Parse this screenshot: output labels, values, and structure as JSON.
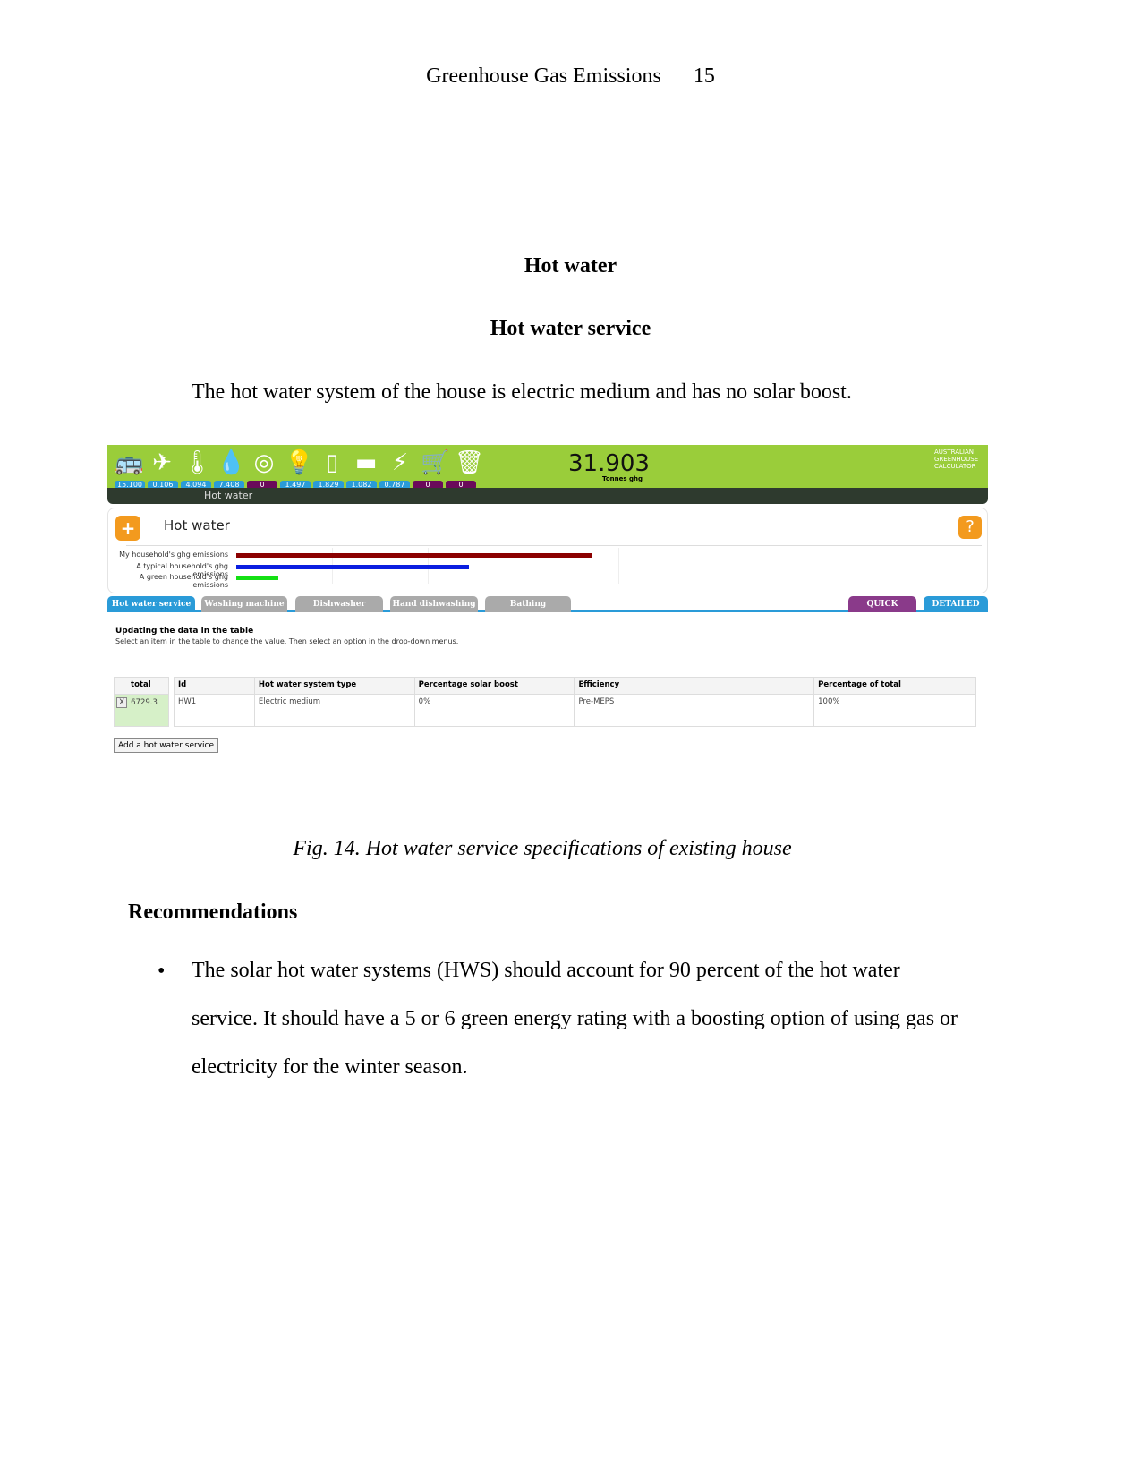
{
  "header": {
    "title": "Greenhouse Gas Emissions",
    "page": "15"
  },
  "heading1": "Hot water",
  "heading2": "Hot water service",
  "intro": "The hot water system of the house is electric medium and has no solar boost.",
  "screenshot": {
    "colors": {
      "topbar": "#9acd3a",
      "accent": "#2a9bd8",
      "orange": "#f39a1e"
    },
    "icons": [
      "transport-icon",
      "plane-icon",
      "heating-cooling-icon",
      "hot-water-icon",
      "washing-machine-icon",
      "lightbulb-icon",
      "fridge-icon",
      "cooking-icon",
      "appliances-icon",
      "shopping-cart-icon",
      "waste-bin-icon"
    ],
    "badges": [
      "15.100",
      "0.106",
      "4.094",
      "7.408",
      "0",
      "1.497",
      "1.829",
      "1.082",
      "0.787",
      "0",
      "0"
    ],
    "total": "31.903",
    "total_unit": "Tonnes ghg",
    "logo": "AUSTRALIAN GREENHOUSE CALCULATOR",
    "section": "Hot water",
    "panel_title": "Hot water",
    "bars": [
      {
        "label": "My household's ghg emissions",
        "fraction": 0.93,
        "color": "#8b0000"
      },
      {
        "label": "A typical household's ghg emissions",
        "fraction": 0.61,
        "color": "#0a1ee0"
      },
      {
        "label": "A green household's ghg emissions",
        "fraction": 0.11,
        "color": "#14e014"
      }
    ],
    "tabs": [
      "Hot water service",
      "Washing machine",
      "Dishwasher",
      "Hand dishwashing",
      "Bathing"
    ],
    "quick": "QUICK",
    "detailed": "DETAILED",
    "update_title": "Updating the data in the table",
    "update_text": "Select an item in the table to change the value. Then select an option in the drop-down menus.",
    "total_col": {
      "header": "total",
      "value": "6729.3",
      "remove": "X"
    },
    "table": {
      "headers": [
        "Id",
        "Hot water system type",
        "Percentage solar boost",
        "Efficiency",
        "Percentage of total"
      ],
      "rows": [
        [
          "HW1",
          "Electric medium",
          "0%",
          "Pre-MEPS",
          "100%"
        ]
      ]
    },
    "add_button": "Add a hot water service"
  },
  "caption": "Fig. 14. Hot water service specifications of existing house",
  "recommendations": {
    "heading": "Recommendations",
    "items": [
      "The solar hot water systems (HWS) should account for 90 percent of the hot water service. It should have a 5 or 6 green energy rating with a boosting option of using gas or electricity for the winter season."
    ]
  }
}
